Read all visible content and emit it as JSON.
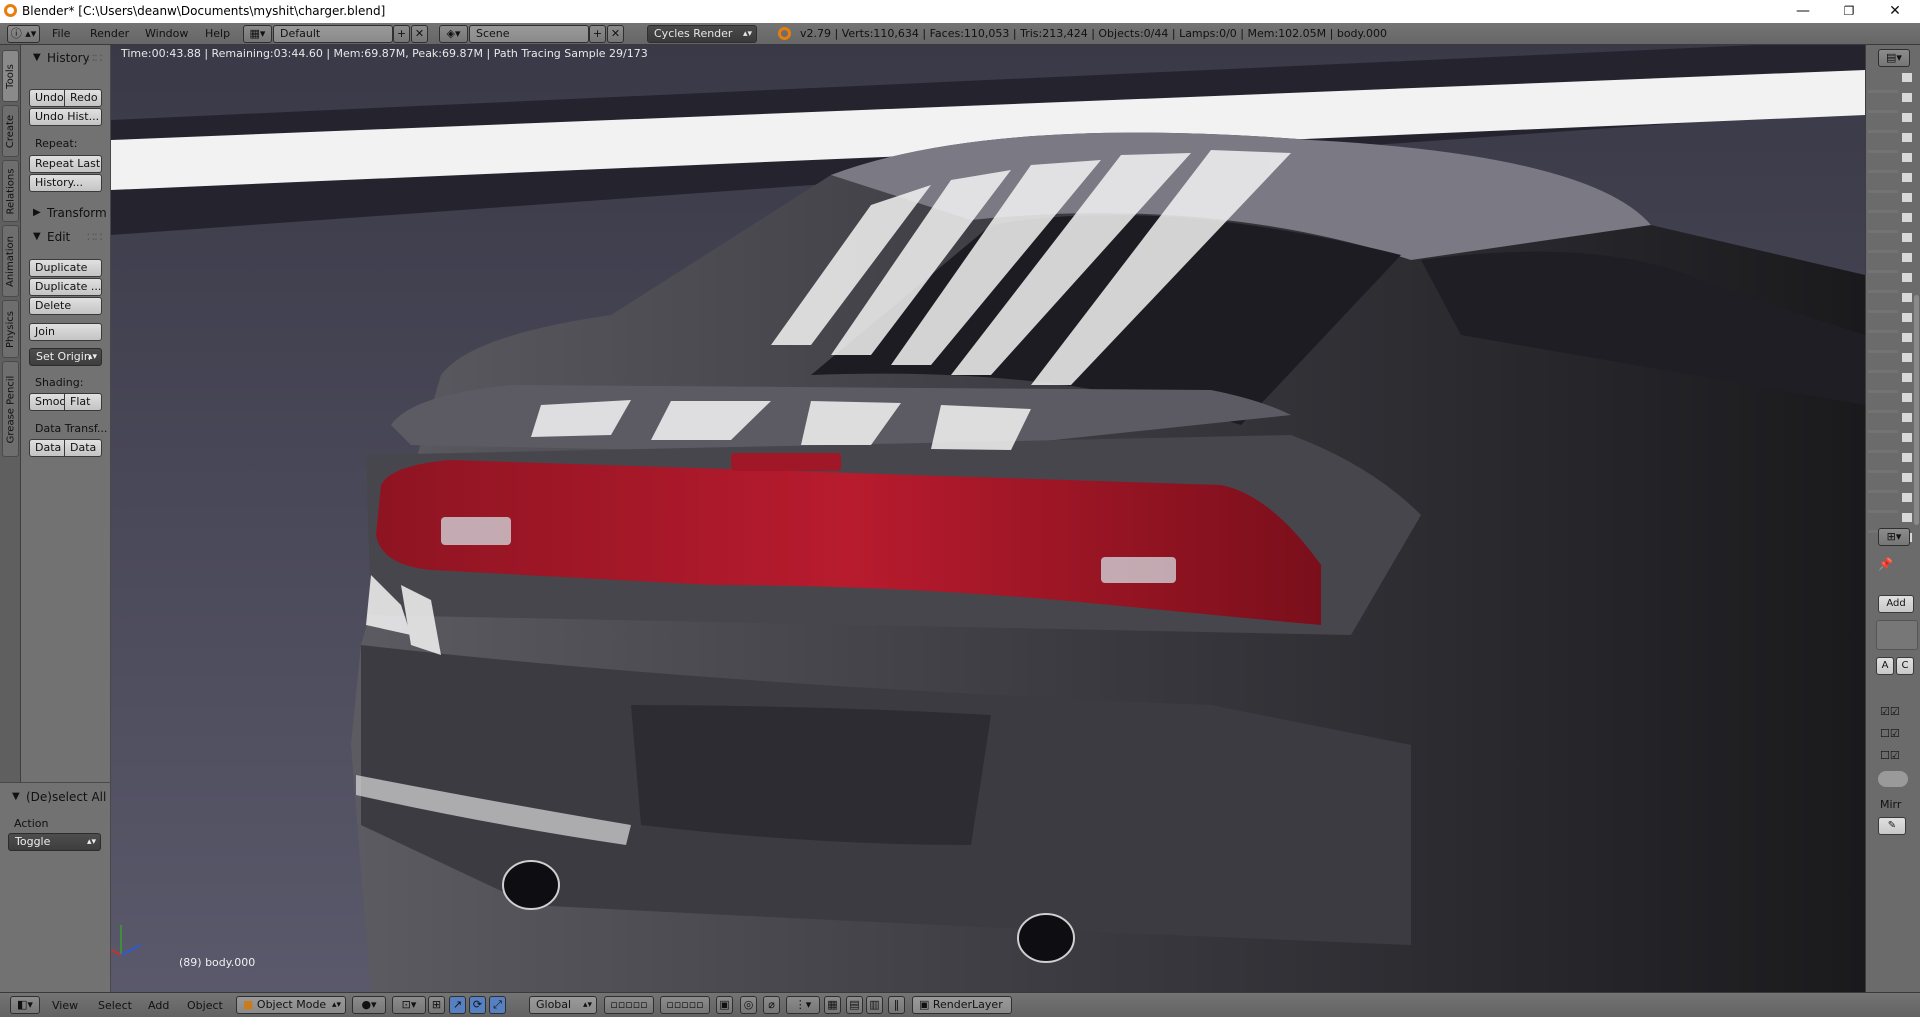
{
  "window": {
    "title": "Blender* [C:\\Users\\deanw\\Documents\\myshit\\charger.blend]",
    "controls": {
      "minimize": "—",
      "restore": "❐",
      "close": "✕"
    }
  },
  "header": {
    "menus": [
      "File",
      "Render",
      "Window",
      "Help"
    ],
    "screen_layout": "Default",
    "scene": "Scene",
    "render_engine": "Cycles Render",
    "stats": "v2.79 | Verts:110,634 | Faces:110,053 | Tris:213,424 | Objects:0/44 | Lamps:0/0 | Mem:102.05M | body.000"
  },
  "tabs": [
    "Tools",
    "Create",
    "Relations",
    "Animation",
    "Physics",
    "Grease Pencil"
  ],
  "toolshelf": {
    "history_title": "History",
    "undo": "Undo",
    "redo": "Redo",
    "undo_history": "Undo Hist...",
    "repeat_label": "Repeat:",
    "repeat_last": "Repeat Last",
    "history_btn": "History...",
    "transform_title": "Transform",
    "edit_title": "Edit",
    "duplicate": "Duplicate",
    "duplicate_linked": "Duplicate ...",
    "delete": "Delete",
    "join": "Join",
    "set_origin": "Set Origin",
    "shading_label": "Shading:",
    "smooth": "Smoo",
    "flat": "Flat",
    "data_transfer_label": "Data Transf...",
    "data1": "Data",
    "data2": "Data"
  },
  "operator": {
    "title": "(De)select All",
    "action_label": "Action",
    "action_value": "Toggle"
  },
  "viewport": {
    "render_status": "Time:00:43.88 | Remaining:03:44.60 | Mem:69.87M, Peak:69.87M | Path Tracing Sample 29/173",
    "object_info": "(89) body.000"
  },
  "right_panel": {
    "add_button": "Add",
    "btn_a": "A",
    "btn_c": "C",
    "mirror_label": "Mirr"
  },
  "footer": {
    "menus": [
      "View",
      "Select",
      "Add",
      "Object"
    ],
    "mode": "Object Mode",
    "orientation": "Global",
    "render_layer": "RenderLayer"
  }
}
